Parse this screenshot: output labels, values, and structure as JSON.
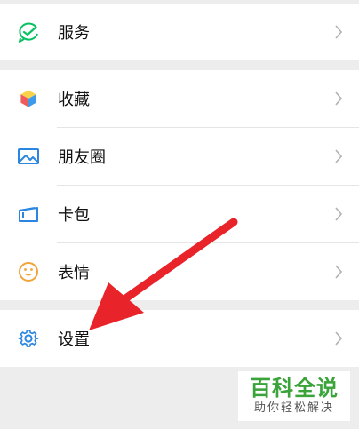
{
  "menu": {
    "group1": [
      {
        "label": "服务",
        "icon": "service-icon"
      }
    ],
    "group2": [
      {
        "label": "收藏",
        "icon": "favorites-cube-icon"
      },
      {
        "label": "朋友圈",
        "icon": "moments-photo-icon"
      },
      {
        "label": "卡包",
        "icon": "card-wallet-icon"
      },
      {
        "label": "表情",
        "icon": "emoji-smile-icon"
      }
    ],
    "group3": [
      {
        "label": "设置",
        "icon": "gear-icon"
      }
    ]
  },
  "watermark": {
    "title": "百科全说",
    "subtitle": "助你轻松解决"
  },
  "colors": {
    "green": "#07c160",
    "blue": "#2a86e0",
    "orange": "#f3a33a",
    "red_arrow": "#e8232a",
    "watermark_green": "#3aa33a"
  }
}
